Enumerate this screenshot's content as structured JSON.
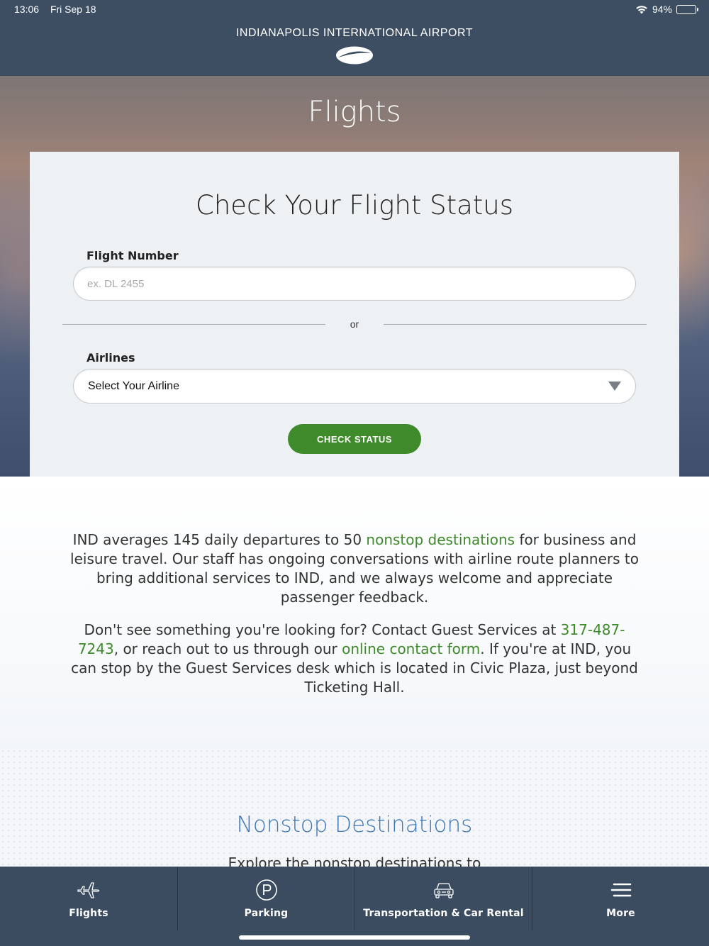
{
  "status_bar": {
    "time": "13:06",
    "date": "Fri Sep 18",
    "battery": "94%",
    "battery_level": 0.94
  },
  "header": {
    "title": "INDIANAPOLIS INTERNATIONAL AIRPORT",
    "logo_icon": "ind-airport-logo-icon"
  },
  "hero": {
    "title": "Flights"
  },
  "flight_status": {
    "title": "Check Your Flight Status",
    "flight_number_label": "Flight Number",
    "flight_number_placeholder": "ex. DL 2455",
    "flight_number_value": "",
    "or_text": "or",
    "airlines_label": "Airlines",
    "airline_selected": "Select Your Airline",
    "button_label": "CHECK STATUS"
  },
  "info": {
    "para1_a": "IND averages 145 daily departures to 50 ",
    "para1_link": "nonstop destinations",
    "para1_b": " for business and leisure travel. Our staff has ongoing conversations with airline route planners to bring additional services to IND, and we always welcome and appreciate passenger feedback.",
    "para2_a": "Don't see something you're looking for? Contact Guest Services at ",
    "para2_phone": "317-487-7243",
    "para2_b": ", or reach out to us through our ",
    "para2_link": "online contact form",
    "para2_c": ". If you're at IND, you can stop by the Guest Services desk which is located in Civic Plaza, just beyond Ticketing Hall."
  },
  "nonstop": {
    "title": "Nonstop Destinations",
    "subtitle": "Explore the nonstop destinations to"
  },
  "bottom_nav": {
    "items": [
      {
        "label": "Flights",
        "icon": "airplane-icon"
      },
      {
        "label": "Parking",
        "icon": "parking-icon"
      },
      {
        "label": "Transportation & Car Rental",
        "icon": "car-icon"
      },
      {
        "label": "More",
        "icon": "menu-icon"
      }
    ]
  },
  "colors": {
    "header_bg": "#3d4e62",
    "accent_green": "#3f8a2b",
    "link_blue": "#3d76b4",
    "nav_bg": "#3b4c60"
  }
}
